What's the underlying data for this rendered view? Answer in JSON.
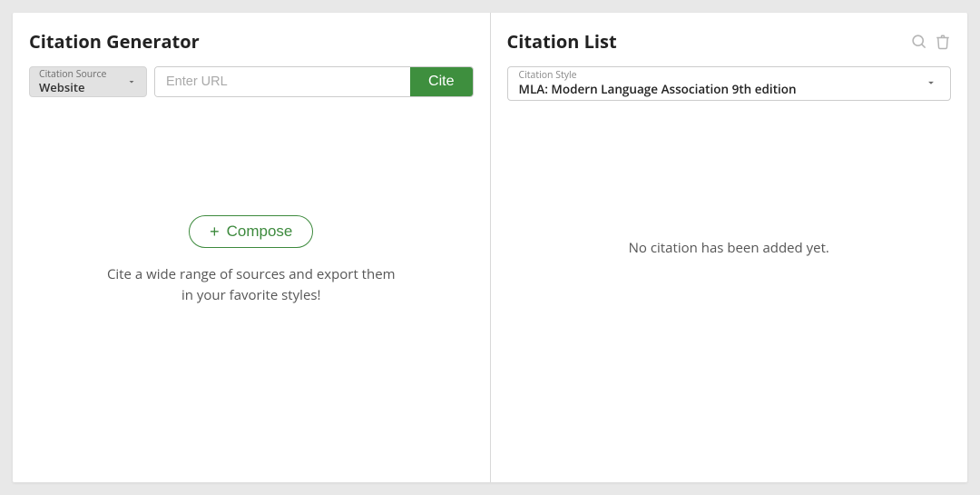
{
  "left": {
    "title": "Citation Generator",
    "source_select": {
      "label": "Citation Source",
      "value": "Website"
    },
    "url_input": {
      "placeholder": "Enter URL",
      "value": ""
    },
    "cite_button_label": "Cite",
    "compose_button_label": "Compose",
    "description": "Cite a wide range of sources and export them in your favorite styles!"
  },
  "right": {
    "title": "Citation List",
    "style_select": {
      "label": "Citation Style",
      "value": "MLA: Modern Language Association 9th edition"
    },
    "empty_message": "No citation has been added yet."
  },
  "colors": {
    "accent_green": "#3e8f3e",
    "border_gray": "#cccccc"
  }
}
